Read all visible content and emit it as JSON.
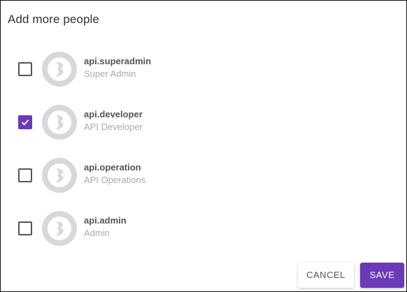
{
  "dialog": {
    "title": "Add more people"
  },
  "people": [
    {
      "username": "api.superadmin",
      "role": "Super Admin",
      "checked": false,
      "avatar_icon": "default-avatar-icon"
    },
    {
      "username": "api.developer",
      "role": "API Developer",
      "checked": true,
      "avatar_icon": "default-avatar-icon"
    },
    {
      "username": "api.operation",
      "role": "API Operations",
      "checked": false,
      "avatar_icon": "default-avatar-icon"
    },
    {
      "username": "api.admin",
      "role": "Admin",
      "checked": false,
      "avatar_icon": "default-avatar-icon"
    }
  ],
  "actions": {
    "cancel_label": "CANCEL",
    "save_label": "SAVE"
  },
  "colors": {
    "accent": "#6a3ab8",
    "avatar_bg": "#d8d8d8"
  }
}
